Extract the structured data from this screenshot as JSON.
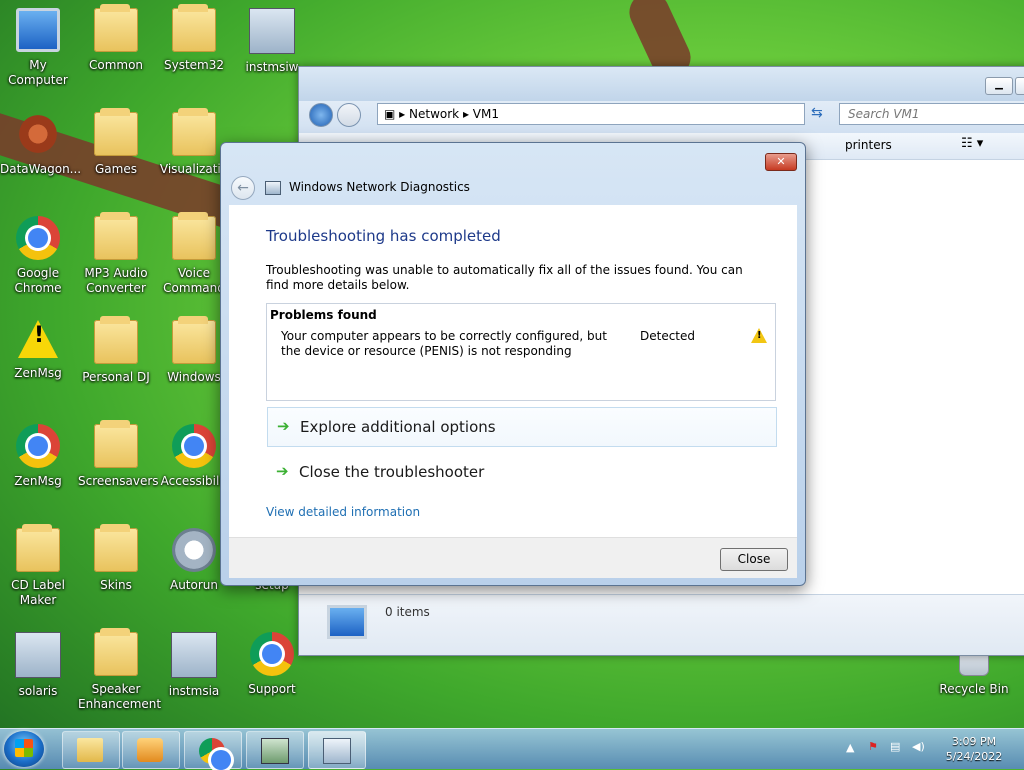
{
  "desktop": {
    "icons": [
      {
        "label": "My Computer",
        "icon": "my-computer-icon"
      },
      {
        "label": "Common",
        "icon": "folder-icon"
      },
      {
        "label": "System32",
        "icon": "folder-icon"
      },
      {
        "label": "instmsiw",
        "icon": "installer-icon"
      },
      {
        "label": "DataWagon...",
        "icon": "datawagon-icon"
      },
      {
        "label": "Games",
        "icon": "folder-icon"
      },
      {
        "label": "Visualizatio",
        "icon": "folder-icon"
      },
      {
        "label": "Google Chrome",
        "icon": "chrome-icon"
      },
      {
        "label": "MP3 Audio Converter",
        "icon": "folder-icon"
      },
      {
        "label": "Voice Command",
        "icon": "folder-icon"
      },
      {
        "label": "ZenMsg",
        "icon": "warning-icon"
      },
      {
        "label": "Personal DJ",
        "icon": "folder-icon"
      },
      {
        "label": "Windows",
        "icon": "folder-icon"
      },
      {
        "label": "ZenMsg",
        "icon": "chrome-icon"
      },
      {
        "label": "Screensavers",
        "icon": "folder-icon"
      },
      {
        "label": "Accessibilit",
        "icon": "chrome-icon"
      },
      {
        "label": "CD Label Maker",
        "icon": "folder-icon"
      },
      {
        "label": "Skins",
        "icon": "folder-icon"
      },
      {
        "label": "Autorun",
        "icon": "gear-icon"
      },
      {
        "label": "setup",
        "icon": "setup-icon"
      },
      {
        "label": "solaris",
        "icon": "solaris-icon"
      },
      {
        "label": "Speaker Enhancement",
        "icon": "folder-icon"
      },
      {
        "label": "instmsia",
        "icon": "installer-icon"
      },
      {
        "label": "Support",
        "icon": "chrome-icon"
      },
      {
        "label": "Recycle Bin",
        "icon": "recycle-bin-icon"
      }
    ]
  },
  "explorer": {
    "breadcrumb": [
      "Network",
      "VM1"
    ],
    "search_placeholder": "Search VM1",
    "command_partial": "printers",
    "status_text": "0 items"
  },
  "dialog": {
    "title": "Windows Network Diagnostics",
    "heading": "Troubleshooting has completed",
    "description": "Troubleshooting was unable to automatically fix all of the issues found. You can find more details below.",
    "problems_header": "Problems found",
    "problem": {
      "text": "Your computer appears to be correctly configured, but the device or resource (PENIS) is not responding",
      "status": "Detected",
      "status_icon": "warning-icon"
    },
    "options": [
      {
        "label": "Explore additional options"
      },
      {
        "label": "Close the troubleshooter"
      }
    ],
    "details_link": "View detailed information",
    "close_label": "Close"
  },
  "taskbar": {
    "time": "3:09 PM",
    "date": "5/24/2022"
  }
}
